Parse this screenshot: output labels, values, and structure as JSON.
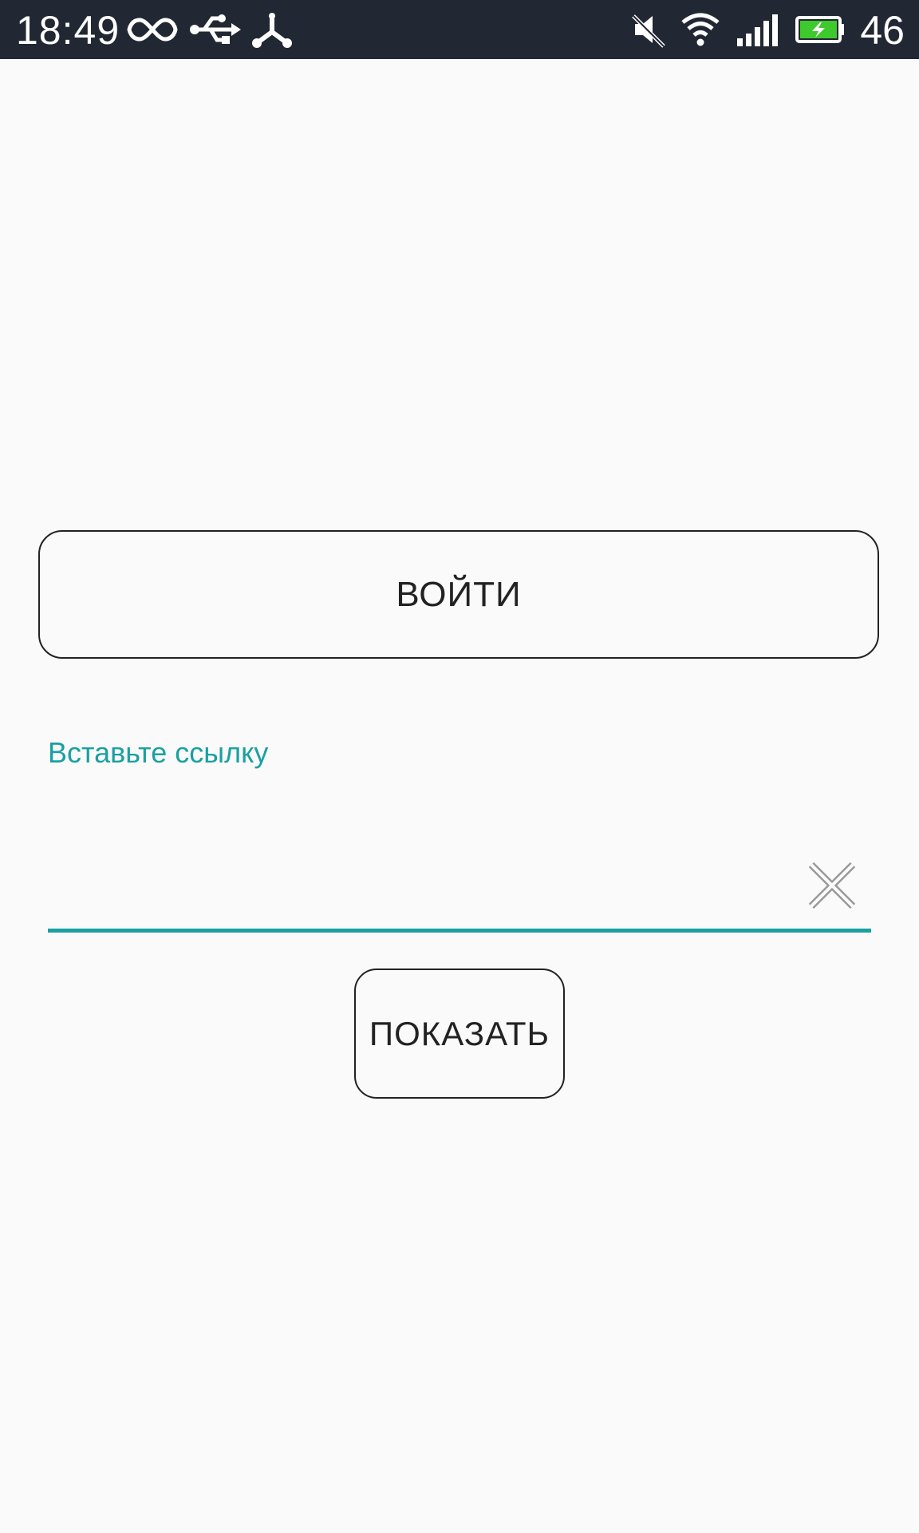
{
  "status_bar": {
    "time": "18:49",
    "battery_percent": "46",
    "icons": [
      "infinity-icon",
      "usb-icon",
      "share-icon",
      "mute-icon",
      "wifi-icon",
      "signal-icon",
      "battery-charging-icon"
    ],
    "battery_color": "#3ec92d"
  },
  "main": {
    "login_button_label": "ВОЙТИ",
    "url_field": {
      "label": "Вставьте ссылку",
      "value": "",
      "accent_color": "#1aa0a3"
    },
    "show_button_label": "ПОКАЗАТЬ"
  }
}
